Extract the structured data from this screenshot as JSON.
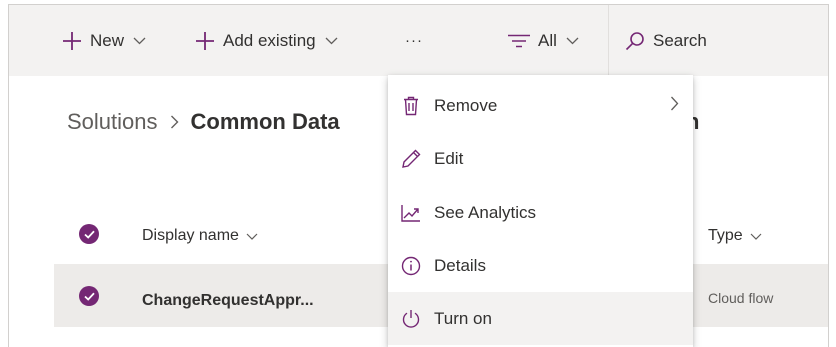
{
  "commandbar": {
    "new_label": "New",
    "add_existing_label": "Add existing",
    "more_label": "···",
    "filter_label": "All",
    "search_label": "Search"
  },
  "breadcrumb": {
    "root": "Solutions",
    "current": "Common Data",
    "tail": "n"
  },
  "table": {
    "columns": [
      "Display name",
      "Type"
    ],
    "rows": [
      {
        "name": "ChangeRequestAppr...",
        "type": "Cloud flow",
        "selected": true
      }
    ]
  },
  "context_menu": {
    "items": [
      {
        "label": "Remove",
        "icon": "trash-icon",
        "has_submenu": true
      },
      {
        "label": "Edit",
        "icon": "pencil-icon"
      },
      {
        "label": "See Analytics",
        "icon": "analytics-icon"
      },
      {
        "label": "Details",
        "icon": "info-icon"
      },
      {
        "label": "Turn on",
        "icon": "power-icon",
        "hovered": true
      }
    ]
  },
  "colors": {
    "accent": "#742774",
    "commandbar_bg": "#f3f2f1",
    "row_selected_bg": "#edebe9",
    "text": "#323130"
  }
}
